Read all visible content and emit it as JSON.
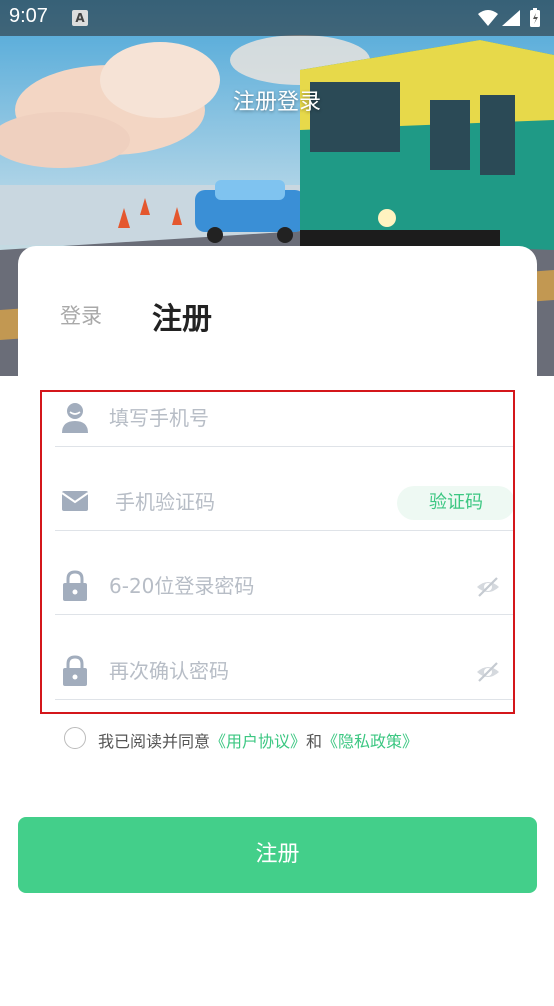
{
  "status_bar": {
    "time": "9:07",
    "notification": "A"
  },
  "header": {
    "title": "注册登录"
  },
  "tabs": {
    "login": "登录",
    "register": "注册"
  },
  "form": {
    "phone": {
      "placeholder": "填写手机号",
      "icon": "user-icon"
    },
    "code": {
      "placeholder": "手机验证码",
      "icon": "mail-icon",
      "button": "验证码"
    },
    "password": {
      "placeholder": "6-20位登录密码",
      "icon": "lock-icon"
    },
    "confirm": {
      "placeholder": "再次确认密码",
      "icon": "lock-icon"
    }
  },
  "agreement": {
    "prefix": "我已阅读并同意",
    "user_agreement": "《用户协议》",
    "and": "和",
    "privacy_policy": "《隐私政策》"
  },
  "submit_label": "注册",
  "colors": {
    "accent": "#43cf8a",
    "link": "#3cc782",
    "highlight": "#d4161b"
  }
}
